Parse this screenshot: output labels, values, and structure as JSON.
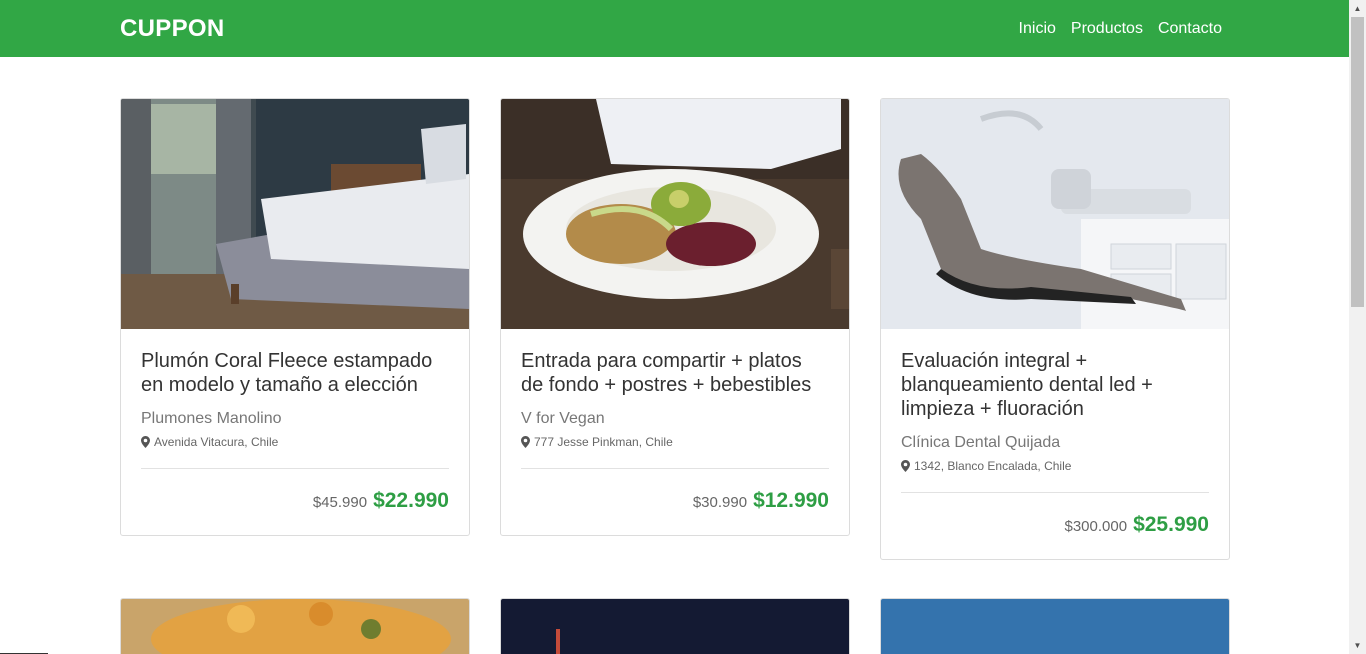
{
  "navbar": {
    "brand": "CUPPON",
    "links": [
      "Inicio",
      "Productos",
      "Contacto"
    ],
    "bg_color": "#31a745"
  },
  "cards": [
    {
      "title": "Plumón Coral Fleece estampado en modelo y tamaño a elección",
      "vendor": "Plumones Manolino",
      "address": "Avenida Vitacura, Chile",
      "old_price": "$45.990",
      "new_price": "$22.990",
      "image": "bedroom-photo"
    },
    {
      "title": "Entrada para compartir + platos de fondo + postres + bebestibles",
      "vendor": "V for Vegan",
      "address": "777 Jesse Pinkman, Chile",
      "old_price": "$30.990",
      "new_price": "$12.990",
      "image": "vegan-plate-photo"
    },
    {
      "title": "Evaluación integral + blanqueamiento dental led + limpieza + fluoración",
      "vendor": "Clínica Dental Quijada",
      "address": "1342, Blanco Encalada, Chile",
      "old_price": "$300.000",
      "new_price": "$25.990",
      "image": "dental-chair-photo"
    }
  ],
  "colors": {
    "price_green": "#2e9e44"
  }
}
